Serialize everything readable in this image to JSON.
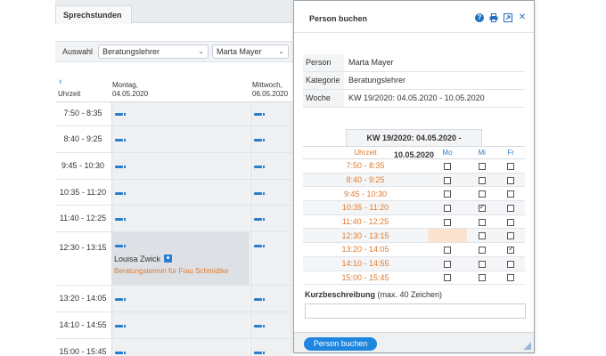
{
  "background": {
    "tab_label": "Sprechstunden",
    "filter_label": "Auswahl",
    "filter_role": "Beratungslehrer",
    "filter_person": "Marta Mayer",
    "nav_back": "‹",
    "time_column_label": "Uhrzeit",
    "days": [
      {
        "line1": "Montag,",
        "line2": "04.05.2020"
      },
      {
        "line1": "Mittwoch,",
        "line2": "06.05.2020"
      }
    ],
    "slots": [
      "7:50 - 8:35",
      "8:40 - 9:25",
      "9:45 - 10:30",
      "10:35 - 11:20",
      "11:40 - 12:25",
      "12:30 - 13:15",
      "13:20 - 14:05",
      "14:10 - 14:55",
      "15:00 - 15:45"
    ],
    "booking": {
      "name": "Louisa Zwick",
      "description": "Beratungstermin für Frau Schmidtke"
    }
  },
  "dialog": {
    "title": "Person buchen",
    "icons": [
      "help-icon",
      "print-icon",
      "external-link-icon",
      "close-icon"
    ],
    "info": [
      {
        "key": "Person",
        "value": "Marta Mayer"
      },
      {
        "key": "Kategorie",
        "value": "Beratungslehrer"
      },
      {
        "key": "Woche",
        "value": "KW 19/2020: 04.05.2020 - 10.05.2020"
      }
    ],
    "week_title": "KW 19/2020: 04.05.2020 - 10.05.2020",
    "columns": {
      "time": "Uhrzeit",
      "d1": "Mo",
      "d2": "Mi",
      "d3": "Fr"
    },
    "rows": [
      {
        "time": "7:50 - 8:35",
        "mo": false,
        "mi": false,
        "fr": false
      },
      {
        "time": "8:40 - 9:25",
        "mo": false,
        "mi": false,
        "fr": false
      },
      {
        "time": "9:45 - 10:30",
        "mo": false,
        "mi": false,
        "fr": false
      },
      {
        "time": "10:35 - 11:20",
        "mo": false,
        "mi": true,
        "fr": false
      },
      {
        "time": "11:40 - 12:25",
        "mo": false,
        "mi": false,
        "fr": false
      },
      {
        "time": "12:30 - 13:15",
        "mo": null,
        "mi": false,
        "fr": false
      },
      {
        "time": "13:20 - 14:05",
        "mo": false,
        "mi": false,
        "fr": true
      },
      {
        "time": "14:10 - 14:55",
        "mo": false,
        "mi": false,
        "fr": false
      },
      {
        "time": "15:00 - 15:45",
        "mo": false,
        "mi": false,
        "fr": false
      }
    ],
    "short_desc_label": "Kurzbeschreibung",
    "short_desc_hint": "(max. 40 Zeichen)",
    "short_desc_value": "",
    "submit_label": "Person buchen"
  },
  "colors": {
    "accent": "#1f86e0",
    "time_text": "#e07a2e",
    "busy": "#fbe3cf"
  }
}
